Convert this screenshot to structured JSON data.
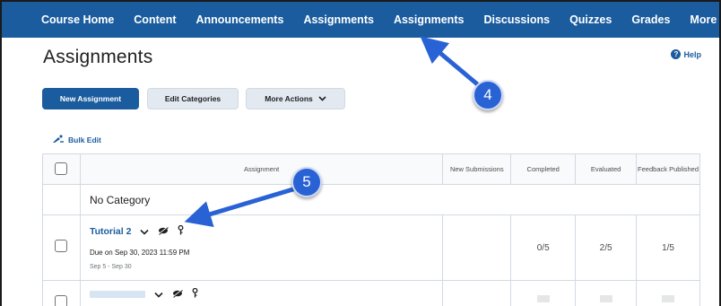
{
  "nav": {
    "items": [
      "Course Home",
      "Content",
      "Announcements",
      "Assignments",
      "Assignments",
      "Discussions",
      "Quizzes",
      "Grades",
      "More"
    ]
  },
  "page": {
    "title": "Assignments",
    "help_label": "Help"
  },
  "toolbar": {
    "new_assignment": "New Assignment",
    "edit_categories": "Edit Categories",
    "more_actions": "More Actions"
  },
  "bulk_edit": "Bulk Edit",
  "table": {
    "columns": [
      "Assignment",
      "New Submissions",
      "Completed",
      "Evaluated",
      "Feedback Published"
    ],
    "category": "No Category",
    "rows": [
      {
        "name": "Tutorial 2",
        "due": "Due on Sep 30, 2023 11:59 PM",
        "dates": "Sep 5 - Sep 30",
        "new_submissions": "",
        "completed": "0/5",
        "evaluated": "2/5",
        "feedback": "1/5"
      }
    ]
  },
  "callouts": {
    "step4": "4",
    "step5": "5"
  },
  "colors": {
    "nav_bg": "#1b5c9e",
    "accent": "#1b5c9e",
    "callout": "#2962d4"
  },
  "icons": [
    "chevron-down-icon",
    "eye-slash-icon",
    "key-icon",
    "question-icon",
    "bulk-edit-icon"
  ]
}
